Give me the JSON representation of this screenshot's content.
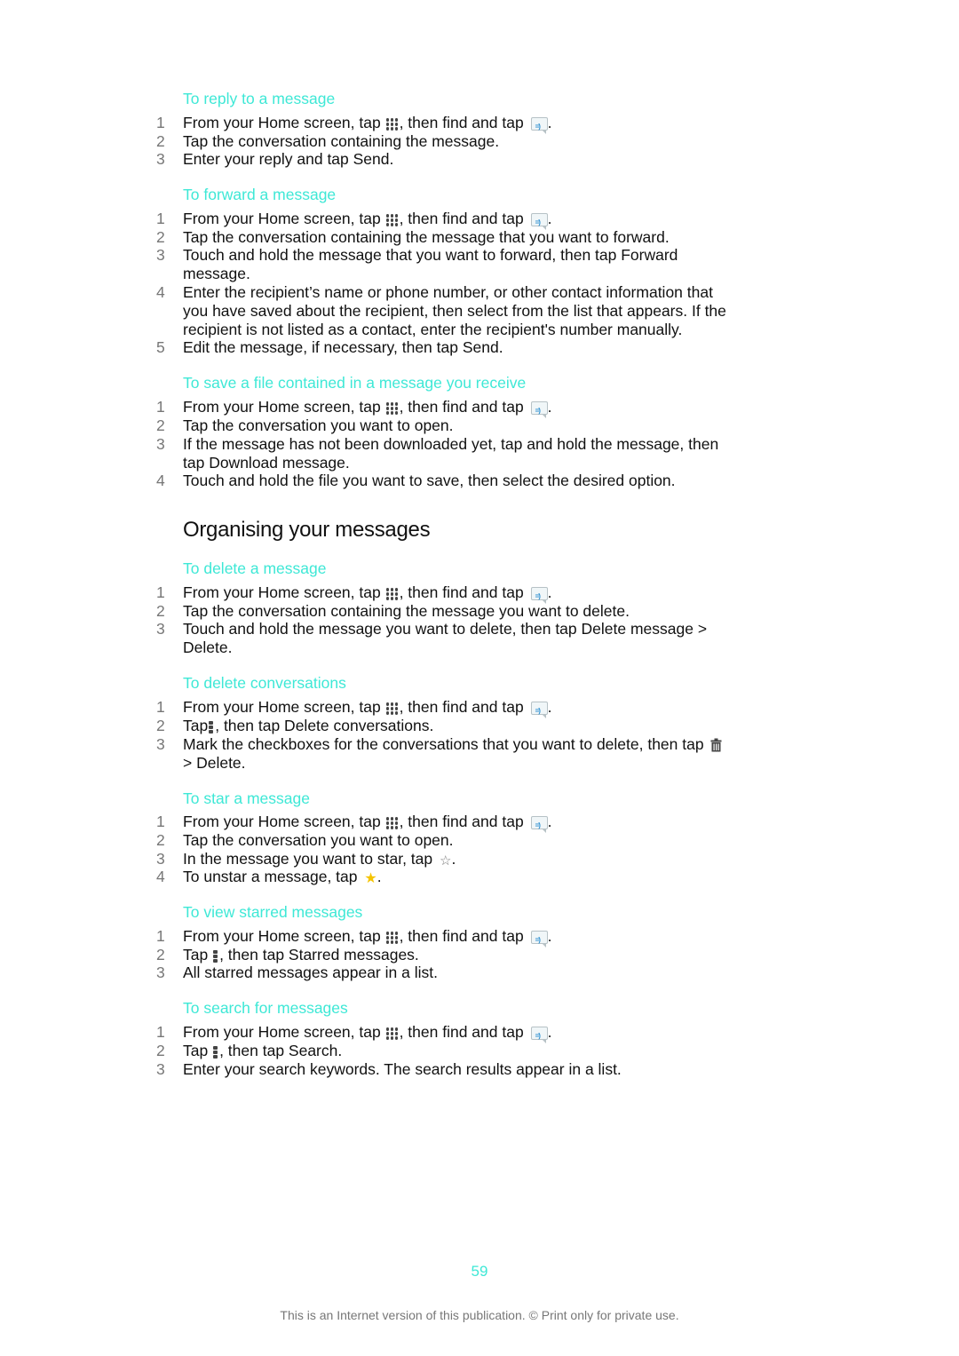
{
  "sections": [
    {
      "title": "To reply to a message",
      "steps": [
        {
          "num": "1",
          "lines": [
            [
              "From your Home screen, tap ",
              "{apps}",
              ", then find and tap ",
              "{msg}",
              "."
            ]
          ]
        },
        {
          "num": "2",
          "lines": [
            [
              "Tap the conversation containing the message."
            ]
          ]
        },
        {
          "num": "3",
          "lines": [
            [
              "Enter your reply and tap Send."
            ]
          ]
        }
      ]
    },
    {
      "title": "To forward a message",
      "steps": [
        {
          "num": "1",
          "lines": [
            [
              "From your Home screen, tap ",
              "{apps}",
              ", then find and tap ",
              "{msg}",
              "."
            ]
          ]
        },
        {
          "num": "2",
          "lines": [
            [
              "Tap the conversation containing the message that you want to forward."
            ]
          ]
        },
        {
          "num": "3",
          "lines": [
            [
              "Touch and hold the message that you want to forward, then tap Forward"
            ],
            [
              "message."
            ]
          ]
        },
        {
          "num": "4",
          "lines": [
            [
              "Enter the recipient’s name or phone number, or other contact information that"
            ],
            [
              "you have saved about the recipient, then select from the list that appears. If the"
            ],
            [
              "recipient is not listed as a contact, enter the recipient's number manually."
            ]
          ]
        },
        {
          "num": "5",
          "lines": [
            [
              "Edit the message, if necessary, then tap Send."
            ]
          ]
        }
      ]
    },
    {
      "title": "To save a file contained in a message you receive",
      "steps": [
        {
          "num": "1",
          "lines": [
            [
              "From your Home screen, tap ",
              "{apps}",
              ", then find and tap ",
              "{msg}",
              "."
            ]
          ]
        },
        {
          "num": "2",
          "lines": [
            [
              "Tap the conversation you want to open."
            ]
          ]
        },
        {
          "num": "3",
          "lines": [
            [
              "If the message has not been downloaded yet, tap and hold the message, then"
            ],
            [
              "tap Download message."
            ]
          ]
        },
        {
          "num": "4",
          "lines": [
            [
              "Touch and hold the file you want to save, then select the desired option."
            ]
          ]
        }
      ]
    },
    {
      "title": "To delete a message",
      "steps": [
        {
          "num": "1",
          "lines": [
            [
              "From your Home screen, tap ",
              "{apps}",
              ", then find and tap ",
              "{msg}",
              "."
            ]
          ]
        },
        {
          "num": "2",
          "lines": [
            [
              "Tap the conversation containing the message you want to delete."
            ]
          ]
        },
        {
          "num": "3",
          "lines": [
            [
              "Touch and hold the message you want to delete, then tap Delete message >"
            ],
            [
              "Delete."
            ]
          ]
        }
      ]
    },
    {
      "title": "To delete conversations",
      "steps": [
        {
          "num": "1",
          "lines": [
            [
              "From your Home screen, tap ",
              "{apps}",
              ", then find and tap ",
              "{msg}",
              "."
            ]
          ]
        },
        {
          "num": "2",
          "lines": [
            [
              "Tap",
              "{menu}",
              ", then tap Delete conversations."
            ]
          ]
        },
        {
          "num": "3",
          "lines": [
            [
              "Mark the checkboxes for the conversations that you want to delete, then tap ",
              "{trash}"
            ],
            [
              "> Delete."
            ]
          ]
        }
      ]
    },
    {
      "title": "To star a message",
      "steps": [
        {
          "num": "1",
          "lines": [
            [
              "From your Home screen, tap ",
              "{apps}",
              ", then find and tap ",
              "{msg}",
              "."
            ]
          ]
        },
        {
          "num": "2",
          "lines": [
            [
              "Tap the conversation you want to open."
            ]
          ]
        },
        {
          "num": "3",
          "lines": [
            [
              "In the message you want to star, tap ",
              "{star-outline}",
              "."
            ]
          ]
        },
        {
          "num": "4",
          "lines": [
            [
              "To unstar a message, tap ",
              "{star-filled}",
              "."
            ]
          ]
        }
      ]
    },
    {
      "title": "To view starred messages",
      "steps": [
        {
          "num": "1",
          "lines": [
            [
              "From your Home screen, tap ",
              "{apps}",
              ", then find and tap ",
              "{msg}",
              "."
            ]
          ]
        },
        {
          "num": "2",
          "lines": [
            [
              "Tap ",
              "{menu}",
              ", then tap Starred messages."
            ]
          ]
        },
        {
          "num": "3",
          "lines": [
            [
              "All starred messages appear in a list."
            ]
          ]
        }
      ]
    },
    {
      "title": "To search for messages",
      "steps": [
        {
          "num": "1",
          "lines": [
            [
              "From your Home screen, tap ",
              "{apps}",
              ", then find and tap ",
              "{msg}",
              "."
            ]
          ]
        },
        {
          "num": "2",
          "lines": [
            [
              "Tap ",
              "{menu}",
              ", then tap Search."
            ]
          ]
        },
        {
          "num": "3",
          "lines": [
            [
              "Enter your search keywords. The search results appear in a list."
            ]
          ]
        }
      ]
    }
  ],
  "heading": "Organising your messages",
  "icons": {
    "apps": "apps-grid-icon",
    "msg": "messaging-app-icon",
    "menu": "overflow-menu-icon",
    "trash": "trash-icon",
    "star-outline": "star-outline-icon",
    "star-filled": "star-filled-icon"
  },
  "colors": {
    "accent": "#3ee8d6",
    "text": "#111111",
    "muted": "#777777",
    "star": "#f5c400"
  },
  "page_number": "59",
  "footer": "This is an Internet version of this publication. © Print only for private use."
}
